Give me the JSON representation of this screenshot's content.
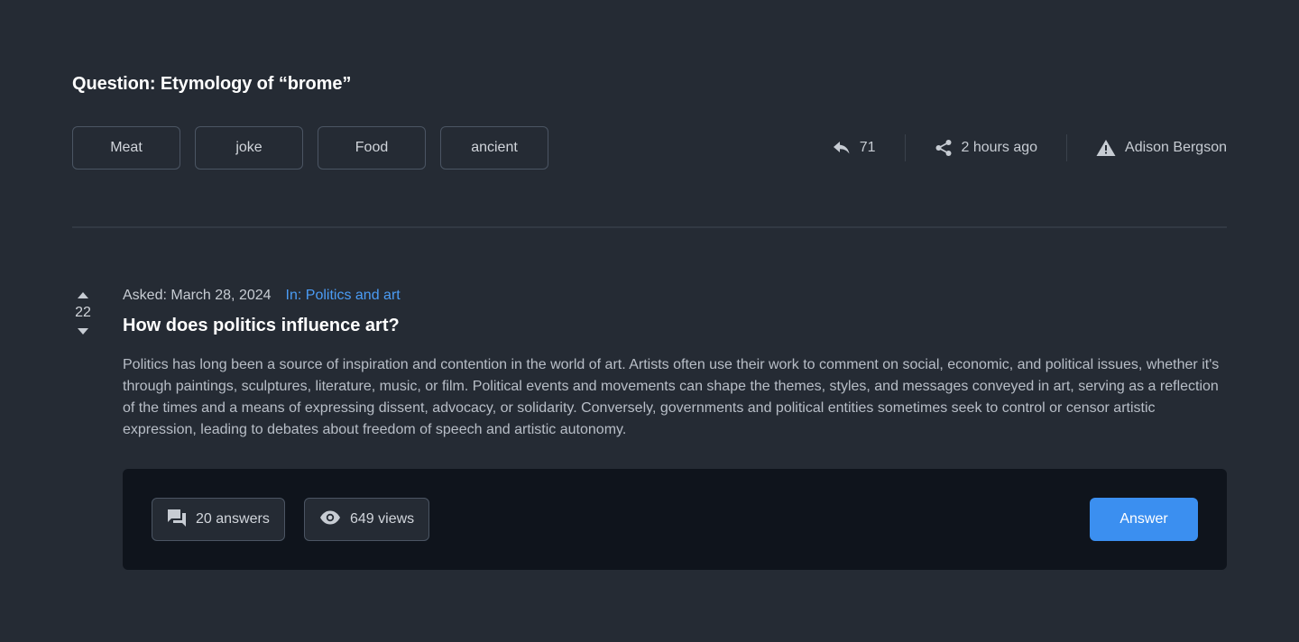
{
  "header": {
    "title": "Question: Etymology of “brome”",
    "tags": [
      "Meat",
      "joke",
      "Food",
      "ancient"
    ],
    "meta": {
      "replies": "71",
      "shared": "2 hours ago",
      "author": "Adison Bergson"
    },
    "icons": {
      "replies": "reply-icon",
      "shared": "share-icon",
      "author": "warning-icon"
    }
  },
  "question": {
    "votes": "22",
    "asked": "Asked: March 28, 2024",
    "category": "In: Politics and art",
    "title": "How does politics influence art?",
    "body": "Politics has long been a source of inspiration and contention in the world of art. Artists often use their work to comment on social, economic, and political issues, whether it's through paintings, sculptures, literature, music, or film. Political events and movements can shape the themes, styles, and messages conveyed in art, serving as a reflection of the times and a means of expressing dissent, advocacy, or solidarity. Conversely, governments and political entities sometimes seek to control or censor artistic expression, leading to debates about freedom of speech and artistic autonomy."
  },
  "footer": {
    "answers": "20 answers",
    "views": "649 views",
    "answer_button": "Answer",
    "icons": {
      "answers": "chat-icon",
      "views": "eye-icon"
    }
  },
  "colors": {
    "background": "#252b34",
    "footer_background": "#0f141c",
    "accent": "#3b8ff0",
    "link": "#4b9cf5"
  }
}
